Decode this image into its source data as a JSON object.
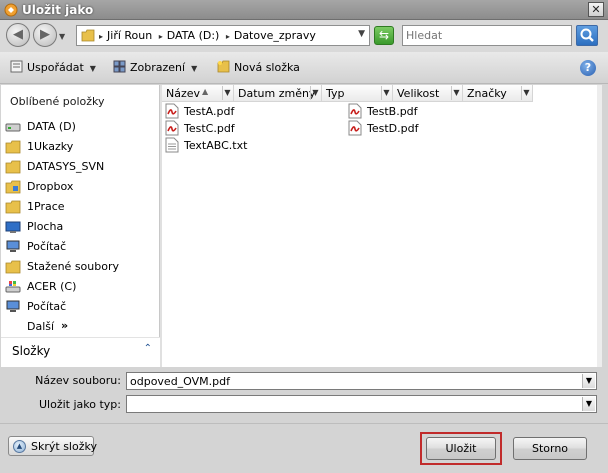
{
  "window": {
    "title": "Uložit jako",
    "close_glyph": "✕"
  },
  "address": {
    "breadcrumbs": [
      "Jiří Roun",
      "DATA (D:)",
      "Datove_zpravy"
    ],
    "separator": "▸",
    "search_placeholder": "Hledat"
  },
  "toolbar": {
    "organize_label": "Uspořádat",
    "views_label": "Zobrazení",
    "new_folder_label": "Nová složka",
    "help_glyph": "?"
  },
  "nav": {
    "favorites_header": "Oblíbené položky",
    "items": [
      {
        "label": "DATA (D)",
        "icon": "drive-icon"
      },
      {
        "label": "1Ukazky",
        "icon": "folder-icon"
      },
      {
        "label": "DATASYS_SVN",
        "icon": "folder-icon"
      },
      {
        "label": "Dropbox",
        "icon": "dropbox-folder-icon"
      },
      {
        "label": "1Prace",
        "icon": "folder-icon"
      },
      {
        "label": "Plocha",
        "icon": "desktop-icon"
      },
      {
        "label": "Počítač",
        "icon": "computer-icon"
      },
      {
        "label": "Stažené soubory",
        "icon": "folder-icon"
      },
      {
        "label": "ACER (C)",
        "icon": "windows-drive-icon"
      },
      {
        "label": "Počítač",
        "icon": "computer-icon"
      },
      {
        "label": "Další",
        "icon": "none"
      }
    ],
    "more_glyph": "»",
    "folders_label": "Složky",
    "folders_glyph": "⌃"
  },
  "columns": [
    {
      "label": "Název"
    },
    {
      "label": "Datum změny"
    },
    {
      "label": "Typ"
    },
    {
      "label": "Velikost"
    },
    {
      "label": "Značky"
    }
  ],
  "files": [
    {
      "name": "TestA.pdf",
      "icon": "pdf-file-icon"
    },
    {
      "name": "TestB.pdf",
      "icon": "pdf-file-icon"
    },
    {
      "name": "TestC.pdf",
      "icon": "pdf-file-icon"
    },
    {
      "name": "TestD.pdf",
      "icon": "pdf-file-icon"
    },
    {
      "name": "TextABC.txt",
      "icon": "text-file-icon"
    }
  ],
  "form": {
    "filename_label": "Název souboru:",
    "filename_value": "odpoved_OVM.pdf",
    "filetype_label": "Uložit jako typ:",
    "filetype_value": ""
  },
  "footer": {
    "hide_folders_label": "Skrýt složky",
    "save_label": "Uložit",
    "cancel_label": "Storno"
  },
  "colors": {
    "highlight_ring": "#c12b2b",
    "pdf_red": "#c8201d",
    "folder_yellow": "#e8c04a"
  }
}
